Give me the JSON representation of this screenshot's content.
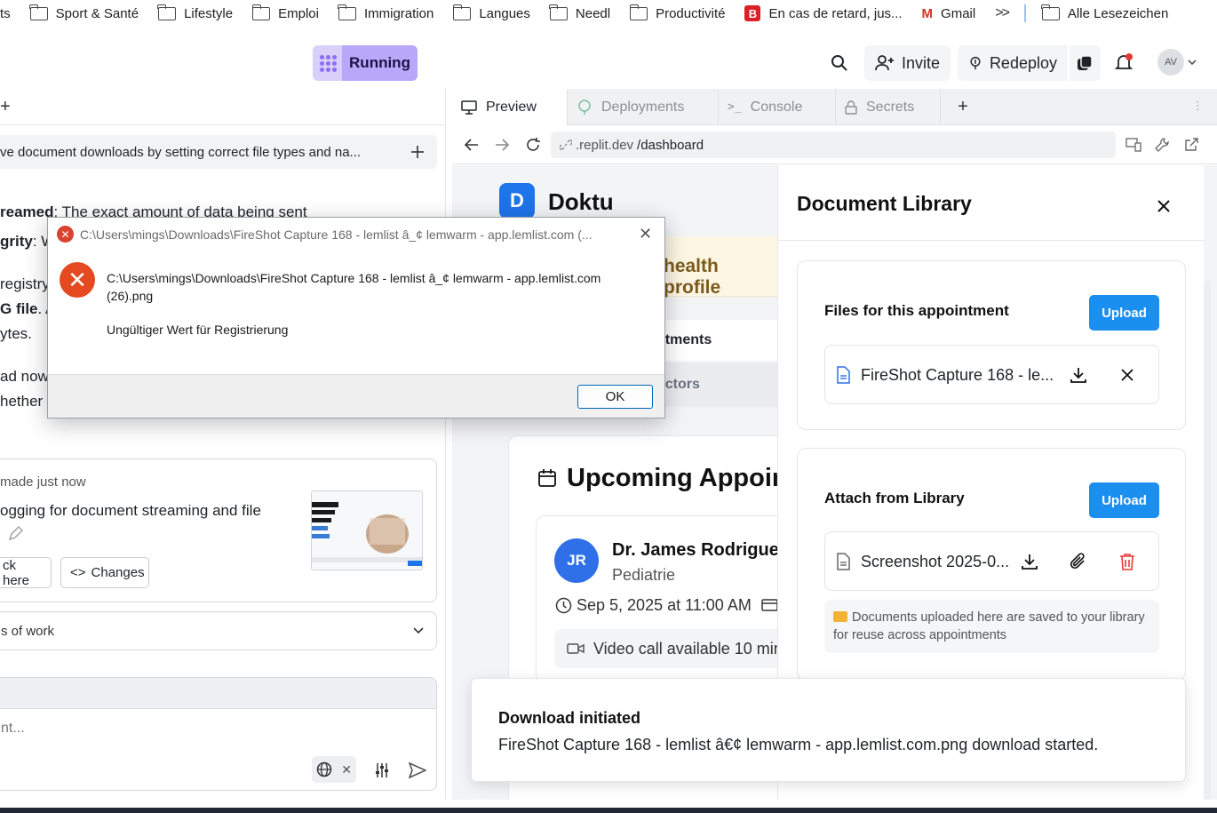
{
  "bookmarks": {
    "partial_first": "ts",
    "items": [
      "Sport & Santé",
      "Lifestyle",
      "Emploi",
      "Immigration",
      "Langues",
      "Needl",
      "Productivité"
    ],
    "retard": "En cas de retard, jus...",
    "gmail": "Gmail",
    "all": "Alle Lesezeichen"
  },
  "topbar": {
    "run_label": "Running",
    "invite": "Invite",
    "redeploy": "Redeploy",
    "avatar": "AV"
  },
  "left": {
    "tab_plus": "+",
    "task_title": "ve document downloads by setting correct file types and na...",
    "line1_bold": "reamed",
    "line1_rest": ": The exact amount of data being sent",
    "line2_bold": "grity",
    "line2_rest": ": W",
    "line3": "registry",
    "line4_bold": "G file",
    "line4_rest": ". A",
    "line5": "ytes.",
    "line6": "ad now",
    "line7": "hether t",
    "card_meta": "made just now",
    "card_text": "ogging for document streaming and file",
    "btn_check": "ck here",
    "btn_changes": "Changes",
    "work_label": "s of work",
    "input_placeholder": "nt..."
  },
  "right": {
    "tabs": [
      "Preview",
      "Deployments",
      "Console",
      "Secrets"
    ],
    "url_host": ".replit.dev",
    "url_path": "/dashboard"
  },
  "page": {
    "logo": "D",
    "brand": "Doktu",
    "health": "health profile",
    "nav_appointments": "ntments",
    "nav_doctors": "octors",
    "upcoming": "Upcoming Appoin",
    "doctor_initials": "JR",
    "doctor_name": "Dr. James Rodriguez",
    "doctor_specialty": "Pediatrie",
    "appt_date": "Sep 5, 2025 at 11:00 AM",
    "video": "Video call available 10 min"
  },
  "drawer": {
    "title": "Document Library",
    "section1_title": "Files for this appointment",
    "section1_upload": "Upload",
    "section1_file": "FireShot Capture 168 - le...",
    "section2_title": "Attach from Library",
    "section2_upload": "Upload",
    "section2_file": "Screenshot 2025-0...",
    "note": "Documents uploaded here are saved to your library for reuse across appointments"
  },
  "toast": {
    "title": "Download initiated",
    "message": "FireShot Capture 168 - lemlist â€¢ lemwarm - app.lemlist.com.png download started."
  },
  "dialog": {
    "title": "C:\\Users\\mings\\Downloads\\FireShot Capture 168 - lemlist â_¢ lemwarm - app.lemlist.com (...",
    "path": "C:\\Users\\mings\\Downloads\\FireShot Capture 168 - lemlist â_¢ lemwarm - app.lemlist.com (26).png",
    "error": "Ungültiger Wert für Registrierung",
    "ok": "OK"
  },
  "colors": {
    "accent_purple": "#b9a7fa",
    "upload_blue": "#1a8ff0",
    "error_red": "#e5491f",
    "delete_red": "#e53935",
    "brand_blue": "#1e74ea"
  }
}
